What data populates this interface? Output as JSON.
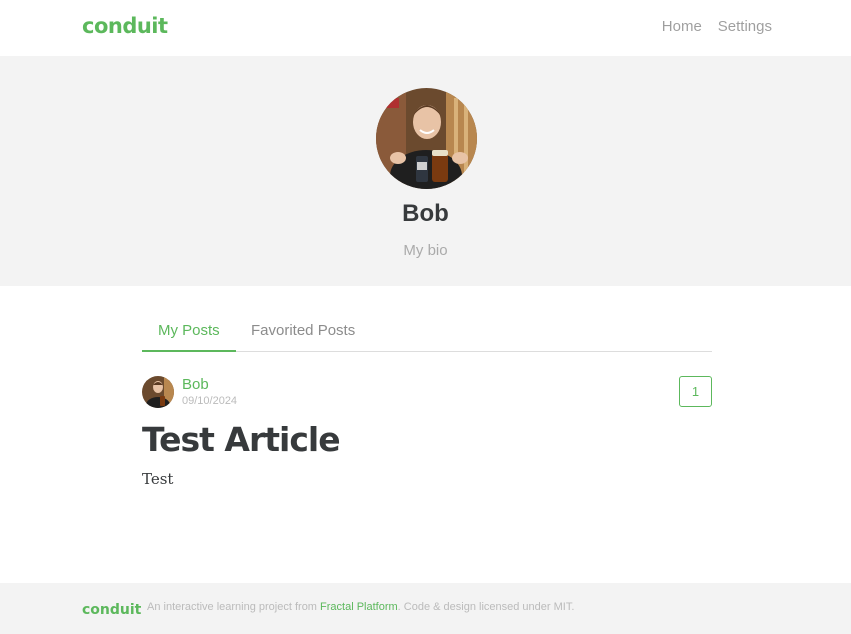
{
  "navbar": {
    "brand": "conduit",
    "links": [
      "Home",
      "Settings"
    ]
  },
  "profile": {
    "name": "Bob",
    "bio": "My bio"
  },
  "tabs": [
    "My Posts",
    "Favorited Posts"
  ],
  "article": {
    "author": "Bob",
    "date": "09/10/2024",
    "favorites_count": "1",
    "title": "Test Article",
    "description": "Test"
  },
  "footer": {
    "brand": "conduit",
    "text_before": "An interactive learning project from ",
    "link_text": "Fractal Platform",
    "text_after": ". Code & design licensed under MIT."
  },
  "colors": {
    "accent": "#5cb85c",
    "banner_bg": "#f3f3f3",
    "text_dark": "#373a3c",
    "muted": "#aaaaaa"
  }
}
